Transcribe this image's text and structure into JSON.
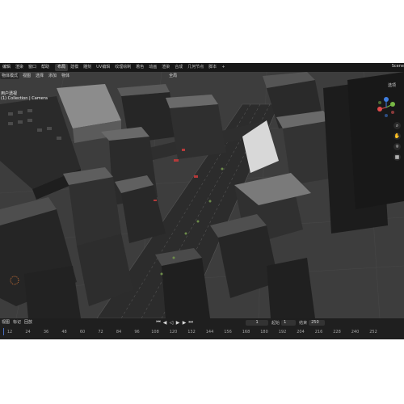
{
  "topbar": {
    "menus": [
      "编辑",
      "渲染",
      "窗口",
      "帮助"
    ],
    "workspaces": [
      "布局",
      "建模",
      "雕刻",
      "UV编辑",
      "纹理绘制",
      "着色",
      "动画",
      "渲染",
      "合成",
      "几何节点",
      "脚本"
    ],
    "active_workspace": "布局",
    "add_tab": "+",
    "scene": "Scene"
  },
  "viewport_header": {
    "mode": "物体模式",
    "menus": [
      "视图",
      "选择",
      "添加",
      "物体"
    ],
    "transform": "全局",
    "options": "选项"
  },
  "viewport_info": {
    "view": "用户透视",
    "collection": "(1) Collection | Camera"
  },
  "gizmo": {
    "x": "X",
    "y": "Y",
    "z": "Z"
  },
  "timeline": {
    "menus": [
      "视图",
      "标记",
      "回放"
    ],
    "current_frame": "1",
    "start_label": "起始",
    "start": "1",
    "end_label": "结束",
    "end": "250",
    "ticks": [
      "12",
      "24",
      "36",
      "48",
      "60",
      "72",
      "84",
      "96",
      "108",
      "120",
      "132",
      "144",
      "156",
      "168",
      "180",
      "192",
      "204",
      "216",
      "228",
      "240",
      "252"
    ]
  },
  "colors": {
    "app_bg": "#1d1d1d",
    "viewport_bg": "#3c3c3c",
    "accent_blue": "#4772b3",
    "gizmo_x": "#e04a4a",
    "gizmo_y": "#78b845",
    "gizmo_z": "#3f7ee0"
  }
}
